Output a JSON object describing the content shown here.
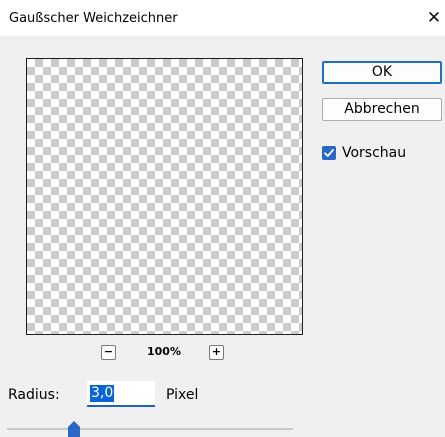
{
  "window": {
    "title": "Gaußscher Weichzeichner",
    "close_glyph": "✕"
  },
  "buttons": {
    "ok_label": "OK",
    "cancel_label": "Abbrechen"
  },
  "preview_checkbox": {
    "label": "Vorschau",
    "checked": true
  },
  "zoom": {
    "minus": "−",
    "level": "100%",
    "plus": "+"
  },
  "radius": {
    "label": "Radius:",
    "value": "3,0",
    "unit": "Pixel",
    "slider_fraction": 0.25
  },
  "colors": {
    "accent": "#2b66c9",
    "selection": "#0a64d8"
  }
}
